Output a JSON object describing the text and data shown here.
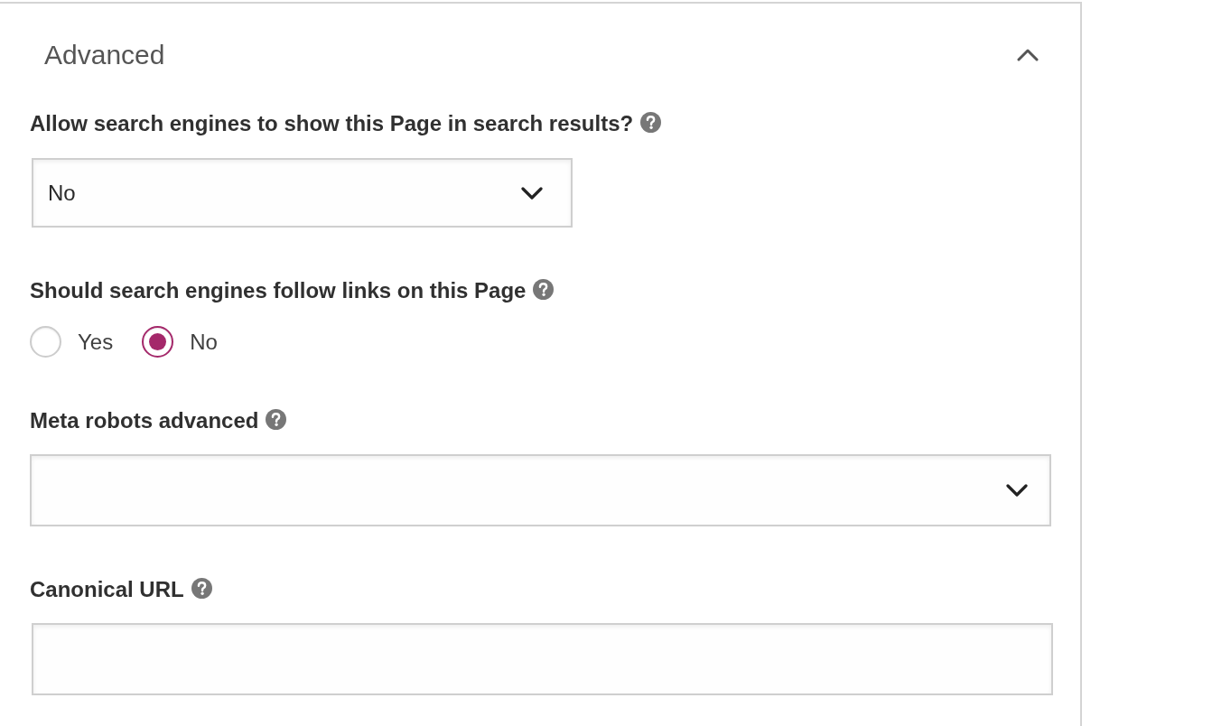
{
  "section": {
    "title": "Advanced",
    "expanded": true
  },
  "fields": [
    {
      "kind": "select",
      "label": "Allow search engines to show this Page in search results?",
      "help": true,
      "value": "No"
    },
    {
      "kind": "radio",
      "label": "Should search engines follow links on this Page",
      "help": true,
      "options": [
        {
          "label": "Yes",
          "selected": false
        },
        {
          "label": "No",
          "selected": true
        }
      ]
    },
    {
      "kind": "multiselect",
      "label": "Meta robots advanced",
      "help": true
    },
    {
      "kind": "text",
      "label": "Canonical URL",
      "help": true
    }
  ]
}
